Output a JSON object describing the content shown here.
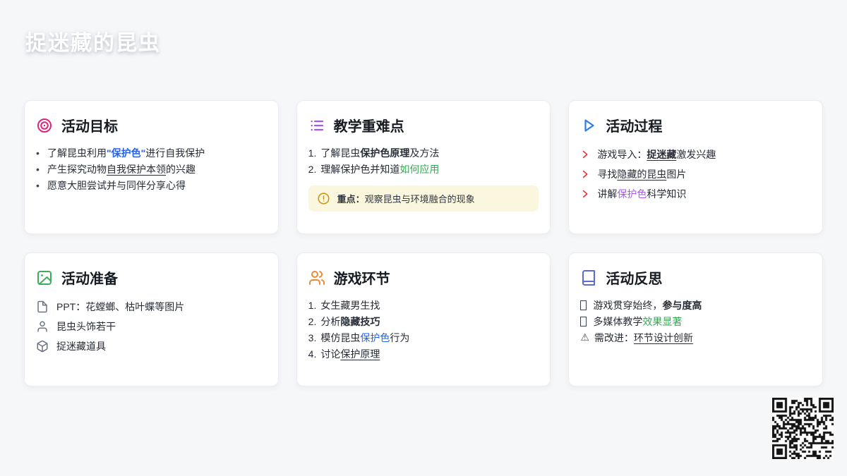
{
  "page": {
    "title": "捉迷藏的昆虫"
  },
  "colors": {
    "accent_blue": "#2563eb",
    "accent_green": "#34a853",
    "accent_purple": "#a855f7",
    "chevron_red": "#e23c3c",
    "icon_pink": "#db2777",
    "icon_purple": "#a855f7",
    "icon_blue": "#2f7be8",
    "icon_green": "#3fae5a",
    "icon_orange": "#ed8936",
    "icon_indigo": "#5b6bd5",
    "prep_icon_gray": "#6b7280",
    "note_bg": "#fbf6de",
    "note_icon": "#c9971c"
  },
  "icons": {
    "goals": "target-icon",
    "key_points": "list-icon",
    "process": "play-icon",
    "preparation": "image-icon",
    "game": "users-icon",
    "reflection": "book-icon",
    "process_marker": "chevron-right-icon",
    "note": "alert-circle-icon",
    "prep_items": [
      "file-icon",
      "person-icon",
      "box-icon"
    ],
    "reflection_markers": [
      "missing-glyph-box",
      "missing-glyph-box",
      "warning-triangle-icon"
    ],
    "bottom_right": "qr-code"
  },
  "goals": {
    "title": "活动目标",
    "items": {
      "i1": {
        "a": "了解昆虫利用",
        "b": "\"保护色\"",
        "c": "进行自我保护"
      },
      "i2": {
        "a": "产生探究动物",
        "b": "自我保护本领",
        "c": "的兴趣"
      },
      "i3": {
        "a": "愿意大胆尝试并与同伴分享心得"
      }
    }
  },
  "key_points": {
    "title": "教学重难点",
    "items": {
      "i1": {
        "num": "1.",
        "a": "了解昆虫",
        "b": "保护色原理",
        "c": "及方法"
      },
      "i2": {
        "num": "2.",
        "a": "理解保护色并知道",
        "b": "如何应用"
      }
    },
    "note": {
      "label": "重点：",
      "text": "观察昆虫与环境融合的现象"
    }
  },
  "process": {
    "title": "活动过程",
    "items": {
      "i1": {
        "a": "游戏导入：",
        "b": "捉迷藏",
        "c": "激发兴趣"
      },
      "i2": {
        "a": "寻找",
        "b": "隐藏的昆虫",
        "c": "图片"
      },
      "i3": {
        "a": "讲解",
        "b": "保护色",
        "c": "科学知识"
      }
    }
  },
  "preparation": {
    "title": "活动准备",
    "items": {
      "i1": {
        "text": "PPT：花螳螂、枯叶蝶等图片"
      },
      "i2": {
        "text": "昆虫头饰若干"
      },
      "i3": {
        "text": "捉迷藏道具"
      }
    }
  },
  "game": {
    "title": "游戏环节",
    "items": {
      "i1": {
        "num": "1.",
        "a": "女生藏男生找"
      },
      "i2": {
        "num": "2.",
        "a": "分析",
        "b": "隐藏技巧"
      },
      "i3": {
        "num": "3.",
        "a": "模仿昆虫",
        "b": "保护色",
        "c": "行为"
      },
      "i4": {
        "num": "4.",
        "a": "讨论",
        "b": "保护原理"
      }
    }
  },
  "reflection": {
    "title": "活动反思",
    "items": {
      "i1": {
        "a": "游戏贯穿始终，",
        "b": "参与度高"
      },
      "i2": {
        "a": "多媒体教学",
        "b": "效果显著"
      },
      "i3": {
        "marker": "⚠",
        "a": "需改进：",
        "b": "环节设计创新"
      }
    }
  }
}
